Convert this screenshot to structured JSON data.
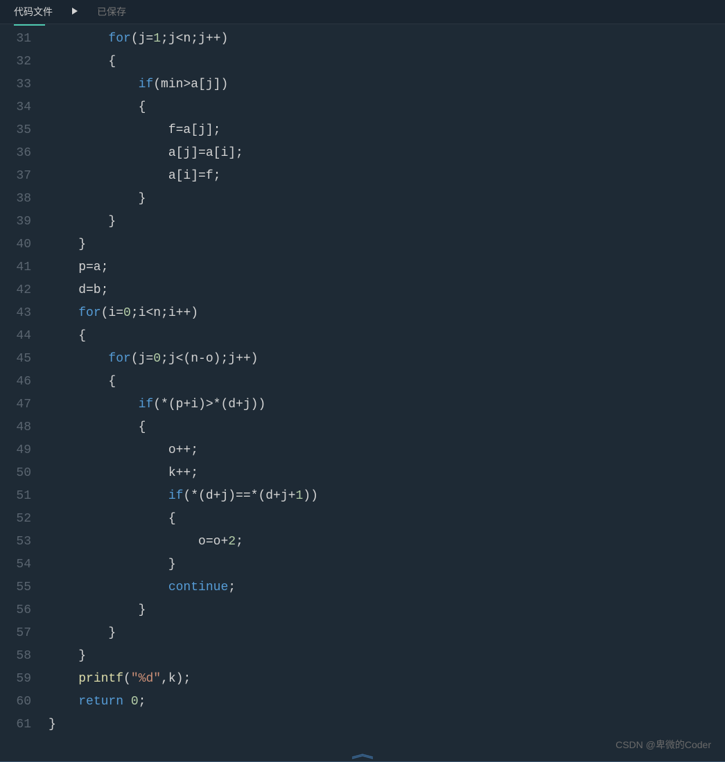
{
  "header": {
    "title": "代码文件",
    "saved": "已保存"
  },
  "watermark": "CSDN @卑微的Coder",
  "lines": [
    {
      "n": 31,
      "code": [
        {
          "t": "        ",
          "c": ""
        },
        {
          "t": "for",
          "c": "kw"
        },
        {
          "t": "(j=",
          "c": ""
        },
        {
          "t": "1",
          "c": "num"
        },
        {
          "t": ";j<n;j++)",
          "c": ""
        }
      ]
    },
    {
      "n": 32,
      "code": [
        {
          "t": "        {",
          "c": ""
        }
      ]
    },
    {
      "n": 33,
      "code": [
        {
          "t": "            ",
          "c": ""
        },
        {
          "t": "if",
          "c": "kw"
        },
        {
          "t": "(min>a[j])",
          "c": ""
        }
      ]
    },
    {
      "n": 34,
      "code": [
        {
          "t": "            {",
          "c": ""
        }
      ]
    },
    {
      "n": 35,
      "code": [
        {
          "t": "                f=a[j];",
          "c": ""
        }
      ]
    },
    {
      "n": 36,
      "code": [
        {
          "t": "                a[j]=a[i];",
          "c": ""
        }
      ]
    },
    {
      "n": 37,
      "code": [
        {
          "t": "                a[i]=f;",
          "c": ""
        }
      ]
    },
    {
      "n": 38,
      "code": [
        {
          "t": "            }",
          "c": ""
        }
      ]
    },
    {
      "n": 39,
      "code": [
        {
          "t": "        }",
          "c": ""
        }
      ]
    },
    {
      "n": 40,
      "code": [
        {
          "t": "    }",
          "c": ""
        }
      ]
    },
    {
      "n": 41,
      "code": [
        {
          "t": "    p=a;",
          "c": ""
        }
      ]
    },
    {
      "n": 42,
      "code": [
        {
          "t": "    d=b;",
          "c": ""
        }
      ]
    },
    {
      "n": 43,
      "code": [
        {
          "t": "    ",
          "c": ""
        },
        {
          "t": "for",
          "c": "kw"
        },
        {
          "t": "(i=",
          "c": ""
        },
        {
          "t": "0",
          "c": "num"
        },
        {
          "t": ";i<n;i++)",
          "c": ""
        }
      ]
    },
    {
      "n": 44,
      "code": [
        {
          "t": "    {",
          "c": ""
        }
      ]
    },
    {
      "n": 45,
      "code": [
        {
          "t": "        ",
          "c": ""
        },
        {
          "t": "for",
          "c": "kw"
        },
        {
          "t": "(j=",
          "c": ""
        },
        {
          "t": "0",
          "c": "num"
        },
        {
          "t": ";j<(n-o);j++)",
          "c": ""
        }
      ]
    },
    {
      "n": 46,
      "code": [
        {
          "t": "        {",
          "c": ""
        }
      ]
    },
    {
      "n": 47,
      "code": [
        {
          "t": "            ",
          "c": ""
        },
        {
          "t": "if",
          "c": "kw"
        },
        {
          "t": "(*(p+i)>*(d+j))",
          "c": ""
        }
      ]
    },
    {
      "n": 48,
      "code": [
        {
          "t": "            {",
          "c": ""
        }
      ]
    },
    {
      "n": 49,
      "code": [
        {
          "t": "                o++;",
          "c": ""
        }
      ]
    },
    {
      "n": 50,
      "code": [
        {
          "t": "                k++;",
          "c": ""
        }
      ]
    },
    {
      "n": 51,
      "code": [
        {
          "t": "                ",
          "c": ""
        },
        {
          "t": "if",
          "c": "kw"
        },
        {
          "t": "(*(d+j)==*(d+j+",
          "c": ""
        },
        {
          "t": "1",
          "c": "num"
        },
        {
          "t": "))",
          "c": ""
        }
      ]
    },
    {
      "n": 52,
      "code": [
        {
          "t": "                {",
          "c": ""
        }
      ]
    },
    {
      "n": 53,
      "code": [
        {
          "t": "                    o=o+",
          "c": ""
        },
        {
          "t": "2",
          "c": "num"
        },
        {
          "t": ";",
          "c": ""
        }
      ]
    },
    {
      "n": 54,
      "code": [
        {
          "t": "                }",
          "c": ""
        }
      ]
    },
    {
      "n": 55,
      "code": [
        {
          "t": "                ",
          "c": ""
        },
        {
          "t": "continue",
          "c": "kw"
        },
        {
          "t": ";",
          "c": ""
        }
      ]
    },
    {
      "n": 56,
      "code": [
        {
          "t": "            }",
          "c": ""
        }
      ]
    },
    {
      "n": 57,
      "code": [
        {
          "t": "        }",
          "c": ""
        }
      ]
    },
    {
      "n": 58,
      "code": [
        {
          "t": "    }",
          "c": ""
        }
      ]
    },
    {
      "n": 59,
      "code": [
        {
          "t": "    ",
          "c": ""
        },
        {
          "t": "printf",
          "c": "fn"
        },
        {
          "t": "(",
          "c": ""
        },
        {
          "t": "\"%d\"",
          "c": "str"
        },
        {
          "t": ",k);",
          "c": ""
        }
      ]
    },
    {
      "n": 60,
      "code": [
        {
          "t": "    ",
          "c": ""
        },
        {
          "t": "return",
          "c": "kw"
        },
        {
          "t": " ",
          "c": ""
        },
        {
          "t": "0",
          "c": "num"
        },
        {
          "t": ";",
          "c": ""
        }
      ]
    },
    {
      "n": 61,
      "code": [
        {
          "t": "}",
          "c": ""
        }
      ]
    }
  ]
}
